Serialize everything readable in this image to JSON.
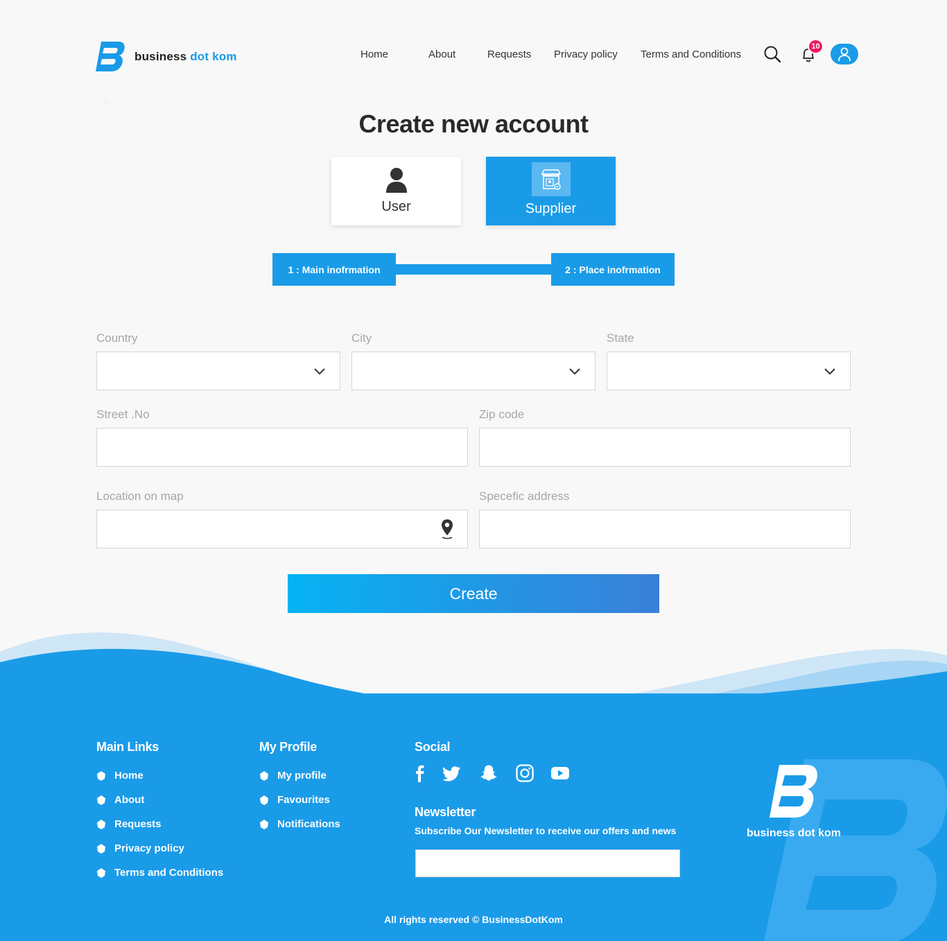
{
  "brand": {
    "name_part1": "business ",
    "name_part2": "dot ",
    "name_part3": "kom",
    "footer_name": "business dot kom"
  },
  "nav": {
    "home": "Home",
    "about": "About",
    "requests": "Requests",
    "privacy": "Privacy policy",
    "terms": "Terms and Conditions"
  },
  "notifications": {
    "count": "10"
  },
  "page": {
    "title": "Create new account"
  },
  "account_types": {
    "user": "User",
    "supplier": "Supplier",
    "selected": "Supplier"
  },
  "steps": {
    "step1": "1 : Main inofrmation",
    "step2": "2 : Place inofrmation"
  },
  "form": {
    "country_label": "Country",
    "city_label": "City",
    "state_label": "State",
    "street_label": "Street .No",
    "zip_label": "Zip code",
    "location_label": "Location on map",
    "address_label": "Specefic address",
    "create_label": "Create"
  },
  "footer": {
    "main_links_heading": "Main Links",
    "main_links": [
      "Home",
      "About",
      "Requests",
      "Privacy policy",
      "Terms and Conditions"
    ],
    "profile_heading": "My Profile",
    "profile_links": [
      "My profile",
      "Favourites",
      "Notifications"
    ],
    "social_heading": "Social",
    "social_icons": [
      "facebook-icon",
      "twitter-icon",
      "snapchat-icon",
      "instagram-icon",
      "youtube-icon"
    ],
    "newsletter_heading": "Newsletter",
    "newsletter_text": "Subscribe Our Newsletter to receive our offers and news",
    "copyright": "All rights reserved © BusinessDotKom"
  },
  "colors": {
    "primary": "#1a9be8",
    "badge": "#ee1a64",
    "gradient_start": "#05b3f3",
    "gradient_end": "#3a7fd8"
  }
}
